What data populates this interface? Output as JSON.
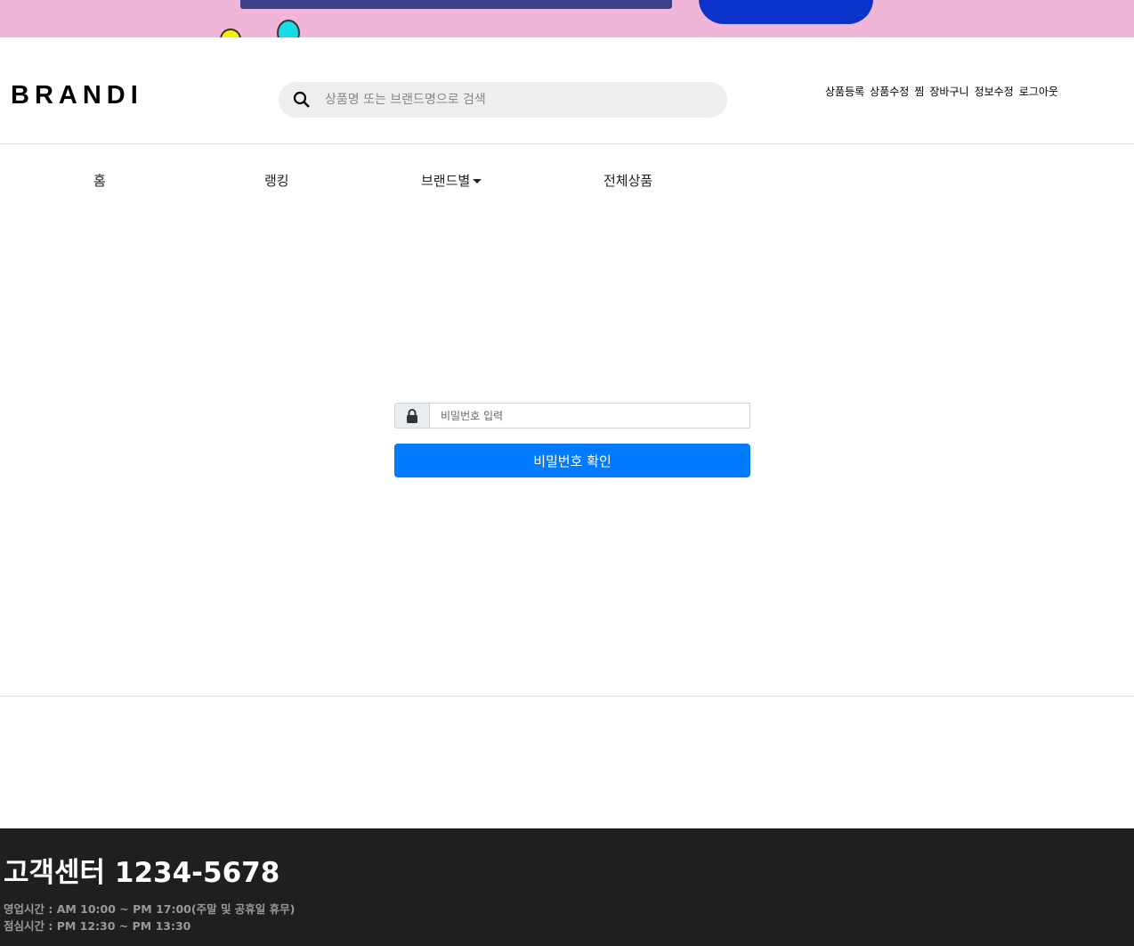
{
  "banner": {
    "colors": {
      "background": "#efb6d8",
      "button": "#0c33c9"
    }
  },
  "header": {
    "logo": "BRANDI",
    "search": {
      "placeholder": "상품명 또는 브랜드명으로 검색",
      "value": "",
      "icon": "search-icon"
    },
    "user_menu": [
      "상품등록",
      "상품수정",
      "찜",
      "장바구니",
      "정보수정",
      "로그아웃"
    ]
  },
  "nav": {
    "items": [
      "홈",
      "랭킹",
      "브랜드별",
      "전체상품"
    ]
  },
  "password_form": {
    "placeholder": "비밀번호 입력",
    "value": "",
    "icon": "lock-icon",
    "button": "비밀번호 확인",
    "accent": "#007bff"
  },
  "footer": {
    "customer_center": "고객센터 1234-5678",
    "business_hours": "영업시간 : AM 10:00 ~ PM 17:00(주말 및 공휴일 휴무)",
    "lunch_hours": "점심시간 : PM 12:30 ~ PM 13:30"
  }
}
